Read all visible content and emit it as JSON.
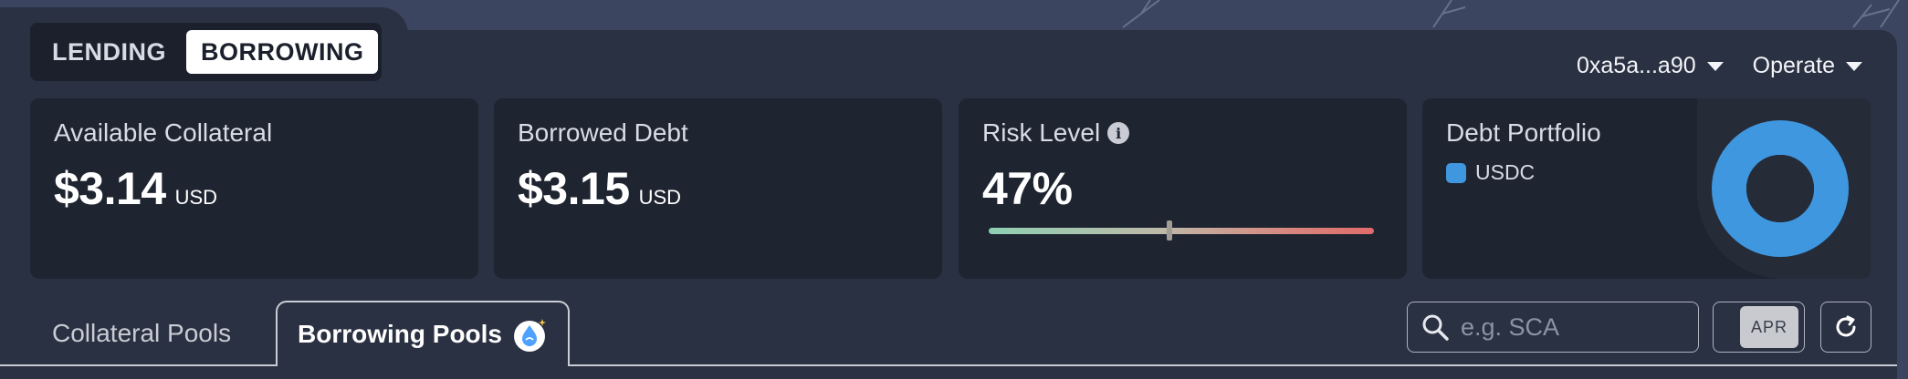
{
  "mode_toggle": {
    "lending": "LENDING",
    "borrowing": "BORROWING",
    "active": "borrowing"
  },
  "header": {
    "wallet": "0xa5a...a90",
    "operate": "Operate"
  },
  "cards": {
    "collateral": {
      "title": "Available Collateral",
      "value": "$3.14",
      "unit": "USD"
    },
    "debt": {
      "title": "Borrowed Debt",
      "value": "$3.15",
      "unit": "USD"
    },
    "risk": {
      "title": "Risk Level",
      "value": "47%",
      "level": 0.47
    },
    "portfolio": {
      "title": "Debt Portfolio",
      "legend": [
        {
          "label": "USDC",
          "color": "#3f97e0",
          "share": 1.0
        }
      ]
    }
  },
  "pool_tabs": {
    "collateral": "Collateral Pools",
    "borrowing": "Borrowing Pools",
    "active": "borrowing"
  },
  "search": {
    "placeholder": "e.g. SCA",
    "value": ""
  },
  "sort_toggle": {
    "label": "APR"
  },
  "icons": [
    "info-icon",
    "caret-down-icon",
    "sui-drop-icon",
    "search-icon",
    "refresh-icon"
  ],
  "colors": {
    "accent": "#3f97e0",
    "panel": "#2a3142",
    "card": "#1f2431"
  }
}
